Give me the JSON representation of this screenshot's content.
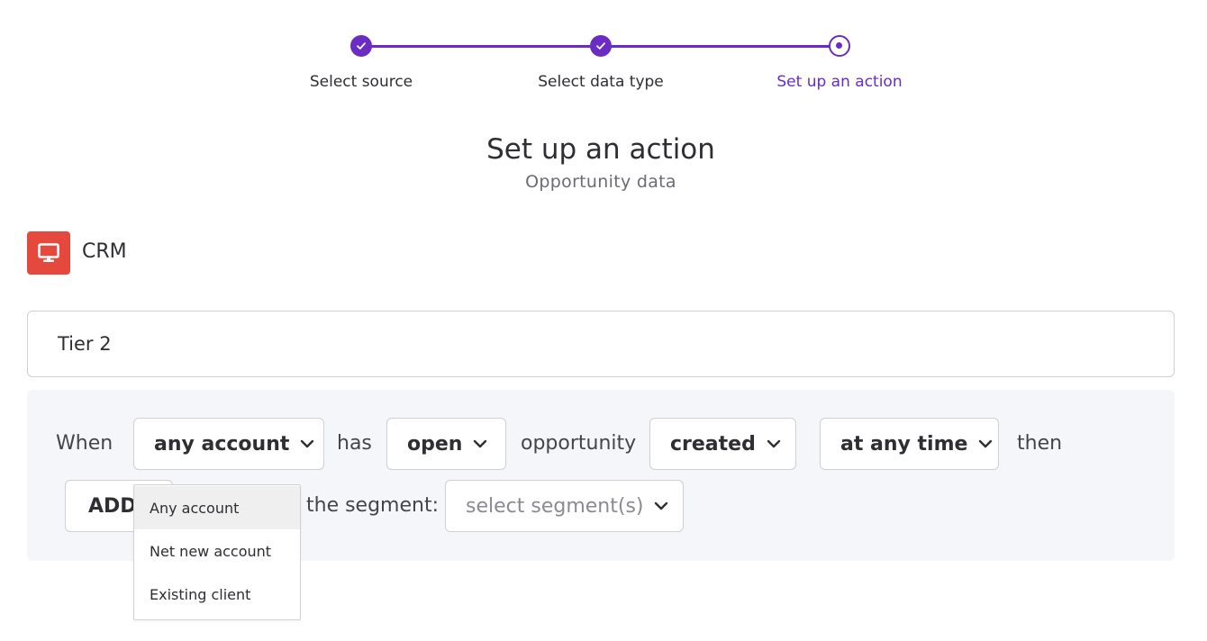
{
  "stepper": {
    "steps": [
      {
        "label": "Select source",
        "state": "done"
      },
      {
        "label": "Select data type",
        "state": "done"
      },
      {
        "label": "Set up an action",
        "state": "current"
      }
    ]
  },
  "header": {
    "title": "Set up an action",
    "subtitle": "Opportunity data"
  },
  "source": {
    "icon": "monitor-icon",
    "label": "CRM",
    "icon_color": "#e5483d"
  },
  "name_field": {
    "value": "Tier 2"
  },
  "rule": {
    "when": "When",
    "account_select": "any account",
    "has": "has",
    "status_select": "open",
    "opportunity": "opportunity",
    "event_select": "created",
    "time_select": "at any time",
    "then": "then",
    "action_select": "ADD",
    "the_segment": "the segment:",
    "segment_select_placeholder": "select segment(s)"
  },
  "account_menu": {
    "options": [
      "Any account",
      "Net new account",
      "Existing client"
    ],
    "hovered_index": 0
  },
  "colors": {
    "accent": "#6a2cc2",
    "panel_bg": "#f5f6fa"
  }
}
